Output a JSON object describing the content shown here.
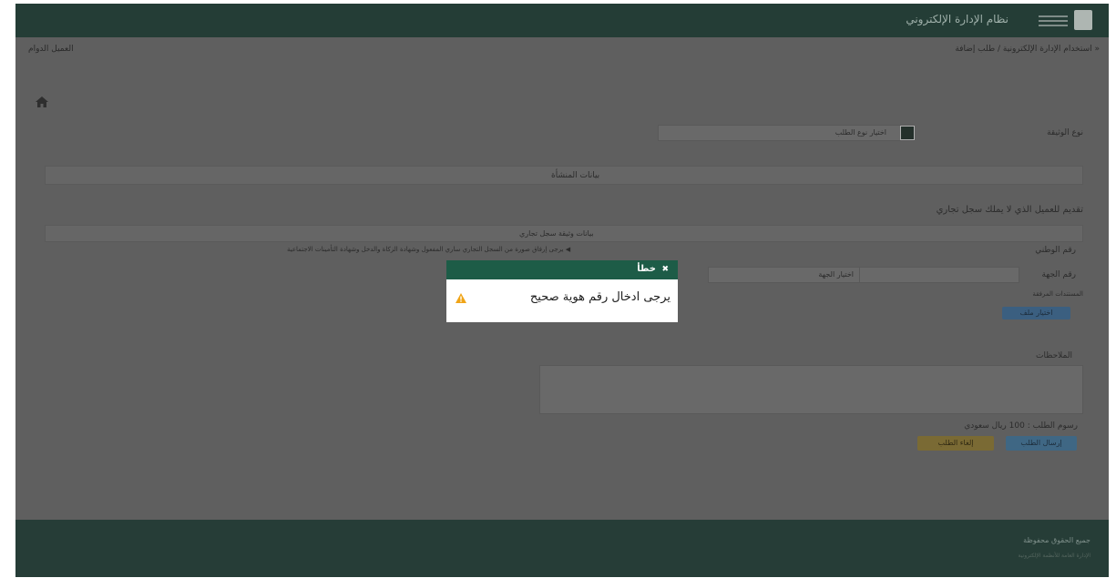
{
  "header": {
    "title": "نظام الإدارة الإلكتروني",
    "menu_icon": "hamburger-menu-icon",
    "logo_icon": "logo-icon"
  },
  "breadcrumb": {
    "text": "« استخدام الإدارة الإلكترونية / طلب إضافة",
    "left_text": "العميل الدوام"
  },
  "form": {
    "request_label": "نوع الوثيقة",
    "request_select_value": "اختيار نوع الطلب",
    "section1_header": "بيانات المنشأة",
    "section2_title": "تقديم للعميل الذي لا يملك سجل تجاري",
    "section2_header": "بيانات وثيقة سجل تجاري",
    "note": "◀ يرجى إرفاق صورة من السجل التجاري ساري المفعول وشهادة الزكاة والدخل وشهادة التأمينات الاجتماعية",
    "label_national": "رقم الوطني",
    "label_entity": "رقم الجهة",
    "placeholder_entity": "اختيار الجهة",
    "label_attachment": "المستندات المرفقة",
    "choose_file": "اختيار ملف",
    "label_notes": "الملاحظات",
    "fee_label": "رسوم الطلب : 100 ريال سعودي",
    "submit_button": "إرسال الطلب",
    "cancel_button": "إلغاء الطلب"
  },
  "footer": {
    "line1": "جميع الحقوق محفوظة",
    "line2": "الإدارة العامة للأنظمة الإلكترونية"
  },
  "modal": {
    "title": "خطأ",
    "close_glyph": "✖",
    "message": "يرجى ادخال رقم هوية صحيح",
    "icon": "warning-icon"
  },
  "colors": {
    "modal_header": "#1d5c47",
    "topbar": "#243d36",
    "warning": "#f0a417"
  }
}
